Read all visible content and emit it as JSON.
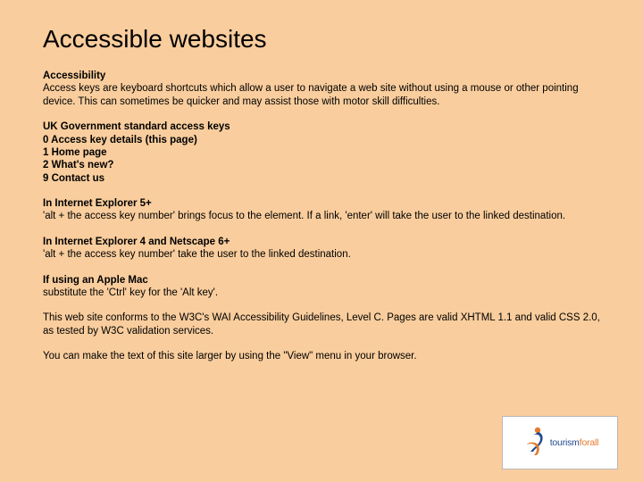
{
  "title": "Accessible websites",
  "sections": {
    "accessibility": {
      "head": "Accessibility",
      "body": "Access keys are keyboard shortcuts which allow a user to navigate a web site without using a mouse or other pointing device. This can sometimes be quicker and may assist those with motor skill difficulties."
    },
    "ukgov": {
      "head": "UK Government standard access keys",
      "items": [
        "0 Access key details (this page)",
        "1 Home page",
        "2 What's new?",
        "9 Contact us"
      ]
    },
    "ie5": {
      "head": "In Internet Explorer 5+",
      "body": "'alt + the access key number' brings focus to the element. If a link, 'enter' will take the user to the linked destination."
    },
    "ie4": {
      "head": "In Internet Explorer 4 and Netscape 6+",
      "body": "'alt + the access key number' take the user to the linked destination."
    },
    "mac": {
      "head": "If using an Apple Mac",
      "body": "substitute the 'Ctrl' key for the 'Alt key'."
    },
    "conform": {
      "body": "This web site conforms to the W3C's WAI Accessibility Guidelines, Level C. Pages are valid XHTML 1.1 and valid CSS 2.0, as tested by W3C validation services."
    },
    "view": {
      "body": "You can make the text of this site larger by using the \"View\" menu in your browser."
    }
  },
  "logo": {
    "part1": "tourism",
    "part2": "forall"
  }
}
